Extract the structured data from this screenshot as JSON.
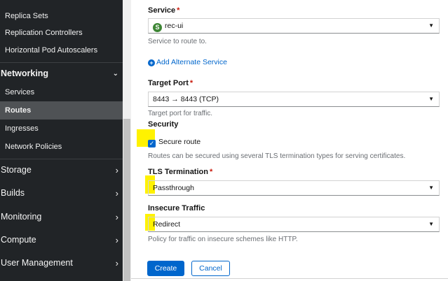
{
  "sidebar": {
    "items": [
      {
        "label": "Replica Sets"
      },
      {
        "label": "Replication Controllers"
      },
      {
        "label": "Horizontal Pod Autoscalers"
      }
    ],
    "networking": {
      "label": "Networking",
      "children": [
        {
          "label": "Services"
        },
        {
          "label": "Routes"
        },
        {
          "label": "Ingresses"
        },
        {
          "label": "Network Policies"
        }
      ]
    },
    "groups": [
      {
        "label": "Storage"
      },
      {
        "label": "Builds"
      },
      {
        "label": "Monitoring"
      },
      {
        "label": "Compute"
      },
      {
        "label": "User Management"
      }
    ]
  },
  "form": {
    "service": {
      "label": "Service",
      "required_mark": "*",
      "badge": "S",
      "value": "rec-ui",
      "help": "Service to route to."
    },
    "add_alternate_service": {
      "icon": "plus-circle-icon",
      "label": "Add Alternate Service"
    },
    "target_port": {
      "label": "Target Port",
      "required_mark": "*",
      "value": "8443 → 8443 (TCP)",
      "help": "Target port for traffic."
    },
    "security": {
      "heading": "Security",
      "secure_route_label": "Secure route",
      "secure_route_checked": true,
      "help": "Routes can be secured using several TLS termination types for serving certificates."
    },
    "tls_termination": {
      "label": "TLS Termination",
      "required_mark": "*",
      "value": "Passthrough"
    },
    "insecure_traffic": {
      "label": "Insecure Traffic",
      "value": "Redirect",
      "help": "Policy for traffic on insecure schemes like HTTP."
    },
    "actions": {
      "create": "Create",
      "cancel": "Cancel"
    }
  },
  "colors": {
    "sidebar_bg": "#212427",
    "sidebar_active": "#4f5255",
    "primary": "#0066cc",
    "required": "#c9190b",
    "highlight": "#fff200",
    "service_badge": "#3e8635"
  }
}
